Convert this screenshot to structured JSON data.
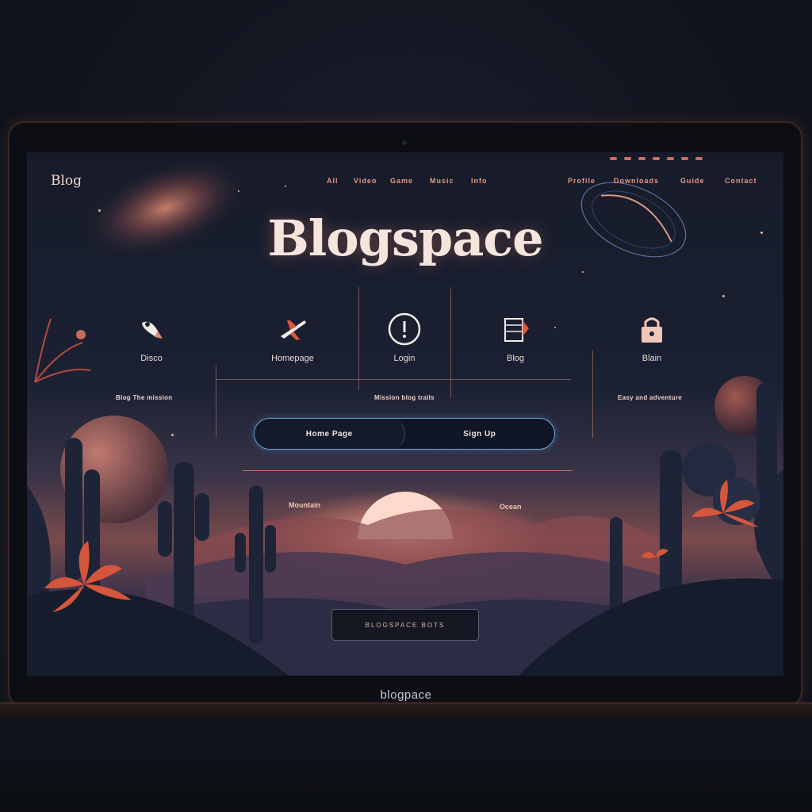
{
  "app": {
    "logo_text": "Blog",
    "hero_title": "Blogspace",
    "device_brand": "blogpace"
  },
  "nav": {
    "left": [
      "All",
      "Video",
      "Game",
      "Music",
      "Info"
    ],
    "right": [
      "Profile",
      "Downloads",
      "Guide",
      "Contact"
    ]
  },
  "features": [
    {
      "label": "Disco",
      "icon": "rocket-icon"
    },
    {
      "label": "Homepage",
      "icon": "airplane-icon"
    },
    {
      "label": "Login",
      "icon": "alert-icon"
    },
    {
      "label": "Blog",
      "icon": "notebook-icon"
    },
    {
      "label": "Blain",
      "icon": "padlock-icon"
    }
  ],
  "feature_descriptions": {
    "left": "Blog The mission",
    "center": "Mission blog trails",
    "right": "Easy and adventure"
  },
  "actions": {
    "homepage_label": "Home Page",
    "signup_label": "Sign Up",
    "cta_label": "BLOGSPACE BOTS"
  },
  "scene": {
    "left_label": "Mountain",
    "right_label": "Ocean"
  },
  "colors": {
    "accent": "#e79a86",
    "pill_border": "#6aa6d8",
    "title": "#f6e5dd"
  }
}
